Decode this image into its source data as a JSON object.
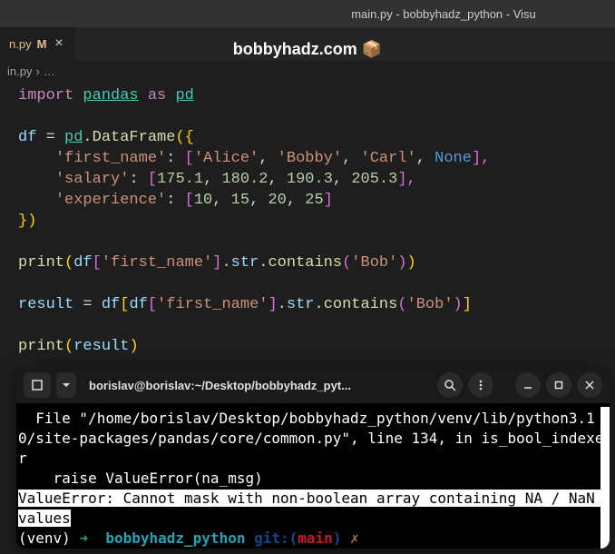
{
  "window": {
    "title": "main.py - bobbyhadz_python - Visu"
  },
  "tab": {
    "filename": "n.py",
    "modified_marker": "M",
    "close_label": "×"
  },
  "watermark": {
    "text": "bobbyhadz.com 📦"
  },
  "breadcrumb": {
    "file": "in.py",
    "separator": "›",
    "ellipsis": "…"
  },
  "code": {
    "l1": {
      "import": "import",
      "pandas": "pandas",
      "as": "as",
      "pd": "pd"
    },
    "l3": {
      "df": "df",
      "eq": "=",
      "pd": "pd",
      "dot": ".",
      "DataFrame": "DataFrame",
      "open": "({"
    },
    "l4": {
      "key": "'first_name'",
      "colon": ":",
      "open": "[",
      "v1": "'Alice'",
      "v2": "'Bobby'",
      "v3": "'Carl'",
      "none": "None",
      "close": "],",
      "c": ","
    },
    "l5": {
      "key": "'salary'",
      "colon": ":",
      "open": "[",
      "v1": "175.1",
      "v2": "180.2",
      "v3": "190.3",
      "v4": "205.3",
      "close": "],",
      "c": ","
    },
    "l6": {
      "key": "'experience'",
      "colon": ":",
      "open": "[",
      "v1": "10",
      "v2": "15",
      "v3": "20",
      "v4": "25",
      "close": "]",
      "c": ","
    },
    "l7": {
      "close": "})"
    },
    "l9": {
      "print": "print",
      "open": "(",
      "df": "df",
      "b1": "[",
      "key": "'first_name'",
      "b2": "]",
      "dot": ".",
      "str": "str",
      "dot2": ".",
      "contains": "contains",
      "p1": "(",
      "arg": "'Bob'",
      "p2": ")",
      "close": ")"
    },
    "l11": {
      "result": "result",
      "eq": "=",
      "df": "df",
      "b1": "[",
      "df2": "df",
      "b2": "[",
      "key": "'first_name'",
      "b3": "]",
      "dot": ".",
      "str": "str",
      "dot2": ".",
      "contains": "contains",
      "p1": "(",
      "arg": "'Bob'",
      "p2": ")",
      "b4": "]"
    },
    "l13": {
      "print": "print",
      "open": "(",
      "result": "result",
      "close": ")"
    }
  },
  "terminal": {
    "title": "borislav@borislav:~/Desktop/bobbyhadz_pyt...",
    "traceback": "  File \"/home/borislav/Desktop/bobbyhadz_python/venv/lib/python3.10/site-packages/pandas/core/common.py\", line 134, in is_bool_indexer\n    raise ValueError(na_msg)",
    "error": "ValueError: Cannot mask with non-boolean array containing NA / NaN values",
    "prompt": {
      "venv": "(venv)",
      "arrow": "➜",
      "dir": "bobbyhadz_python",
      "git": "git:(",
      "branch": "main",
      "gitclose": ")",
      "dirty": "✗"
    }
  }
}
